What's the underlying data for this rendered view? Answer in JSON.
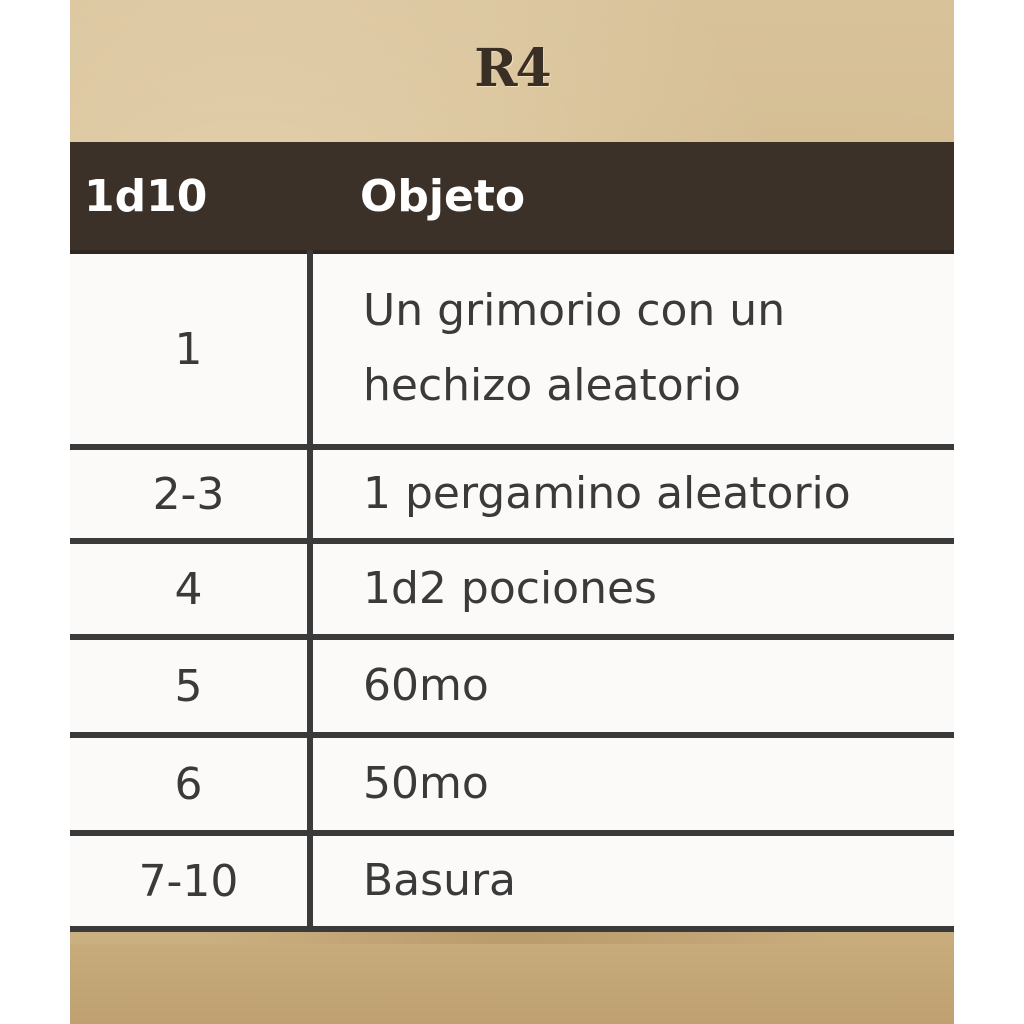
{
  "card": {
    "code": "R4"
  },
  "table": {
    "headers": {
      "roll": "1d10",
      "item": "Objeto"
    },
    "rows": [
      {
        "roll": "1",
        "item": "Un grimorio con un hechizo aleatorio"
      },
      {
        "roll": "2-3",
        "item": "1 pergamino aleatorio"
      },
      {
        "roll": "4",
        "item": "1d2 pociones"
      },
      {
        "roll": "5",
        "item": "60mo"
      },
      {
        "roll": "6",
        "item": "50mo"
      },
      {
        "roll": "7-10",
        "item": "Basura"
      }
    ]
  },
  "colors": {
    "header_bg": "#3b3128",
    "parchment": "#d2b98c",
    "cell_bg": "#fbfaf8",
    "rule": "#3a3a3a"
  }
}
